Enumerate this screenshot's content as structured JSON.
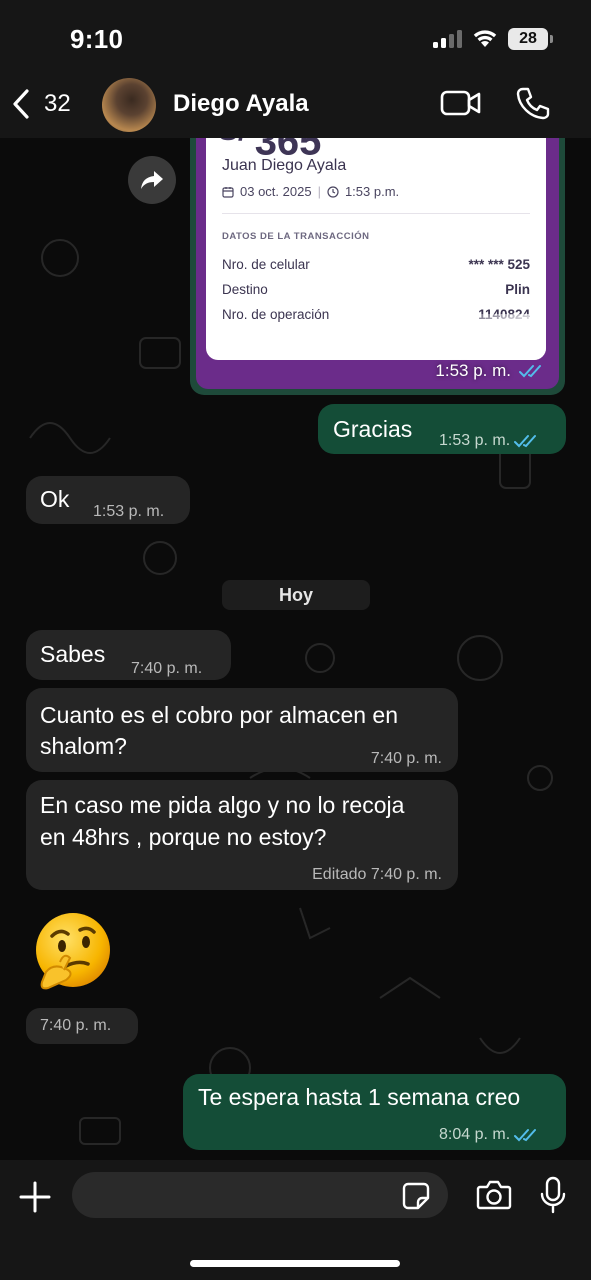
{
  "status_bar": {
    "time": "9:10",
    "battery": "28"
  },
  "header": {
    "back_count": "32",
    "contact_name": "Diego Ayala"
  },
  "receipt": {
    "amount": "365",
    "payer": "Juan Diego Ayala",
    "date": "03 oct. 2025",
    "time": "1:53 p.m.",
    "section_title": "DATOS DE LA TRANSACCIÓN",
    "rows": [
      {
        "label": "Nro. de celular",
        "value": "*** *** 525"
      },
      {
        "label": "Destino",
        "value": "Plin"
      },
      {
        "label": "Nro. de operación",
        "value": "1140824"
      }
    ],
    "message_time": "1:53 p. m."
  },
  "messages": [
    {
      "id": "gracias",
      "direction": "out",
      "text": "Gracias",
      "time": "1:53 p. m."
    },
    {
      "id": "ok",
      "direction": "in",
      "text": "Ok",
      "time": "1:53 p. m."
    },
    {
      "id": "sabes",
      "direction": "in",
      "text": "Sabes",
      "time": "7:40 p. m."
    },
    {
      "id": "cuanto",
      "direction": "in",
      "text_line1": "Cuanto es el cobro por almacen en",
      "text_line2": "shalom?",
      "time": "7:40 p. m."
    },
    {
      "id": "caso",
      "direction": "in",
      "text_line1": "En caso me pida algo y no lo recoja",
      "text_line2": "en 48hrs , porque no estoy?",
      "edited": "Editado",
      "time": "7:40 p. m."
    },
    {
      "id": "emoji",
      "direction": "in",
      "emoji": "thinking-face",
      "time": "7:40 p. m."
    },
    {
      "id": "espera",
      "direction": "out",
      "text": "Te espera hasta 1 semana creo",
      "time": "8:04 p. m."
    }
  ],
  "date_separator": "Hoy",
  "input": {
    "placeholder": ""
  },
  "colors": {
    "outgoing_bubble": "#144d37",
    "incoming_bubble": "#252525",
    "read_ticks": "#53bdeb",
    "receipt_frame": "#6b2c8a"
  }
}
